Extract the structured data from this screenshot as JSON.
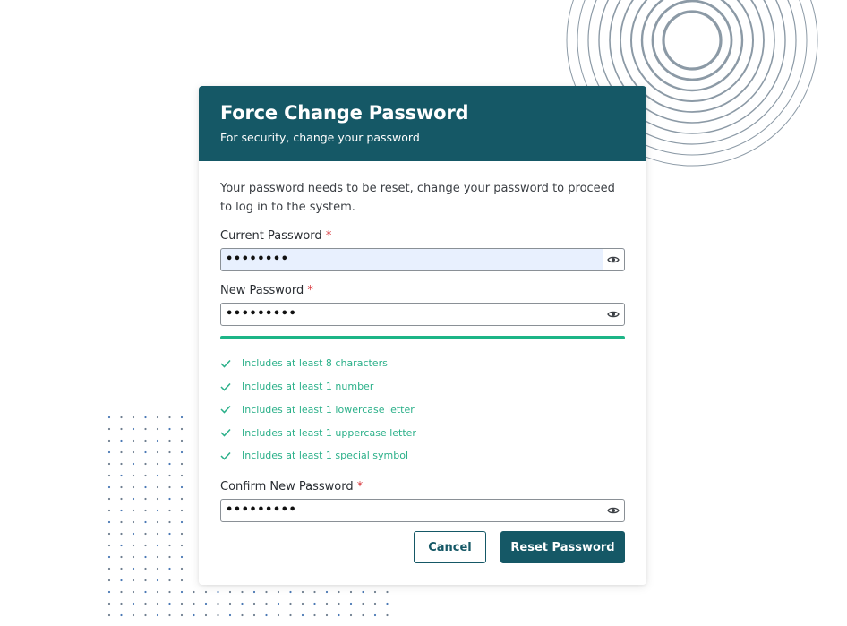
{
  "header": {
    "title": "Force Change Password",
    "subtitle": "For security, change your password"
  },
  "intro": "Your password needs to be reset, change your password to proceed to log in to the system.",
  "fields": {
    "current": {
      "label": "Current Password",
      "required_mark": "*",
      "value": "••••••••",
      "icon": "eye-icon"
    },
    "new": {
      "label": "New Password",
      "required_mark": "*",
      "value": "•••••••••",
      "icon": "eye-icon"
    },
    "confirm": {
      "label": "Confirm New Password",
      "required_mark": "*",
      "value": "•••••••••",
      "icon": "eye-icon"
    }
  },
  "strength": {
    "fraction": 1.0,
    "color": "#1db587"
  },
  "rules": [
    "Includes at least 8 characters",
    "Includes at least 1 number",
    "Includes at least 1 lowercase letter",
    "Includes at least 1 uppercase letter",
    "Includes at least 1 special symbol"
  ],
  "buttons": {
    "cancel": "Cancel",
    "reset": "Reset Password"
  },
  "colors": {
    "brand": "#155866",
    "success": "#2bb089",
    "required": "#d8363b"
  }
}
